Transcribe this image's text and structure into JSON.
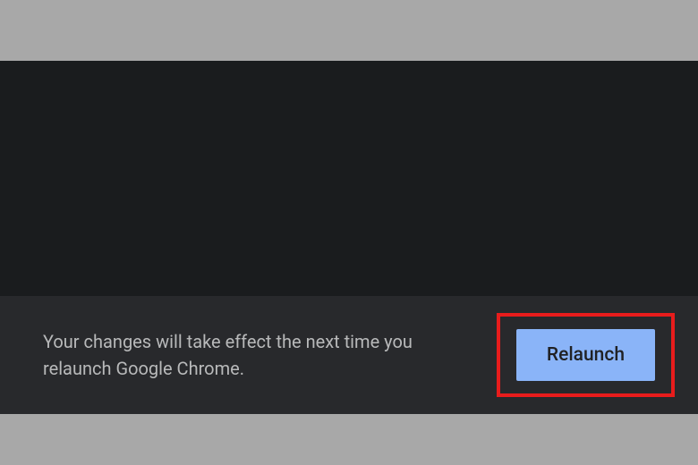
{
  "notification": {
    "message": "Your changes will take effect the next time you relaunch Google Chrome.",
    "button_label": "Relaunch"
  },
  "colors": {
    "background_outer": "#a8a8a8",
    "background_upper": "#1a1c1e",
    "background_bar": "#28292c",
    "button_bg": "#8ab4f8",
    "button_text": "#202124",
    "highlight_border": "#e81c1c",
    "text_muted": "#b8b9ba"
  }
}
